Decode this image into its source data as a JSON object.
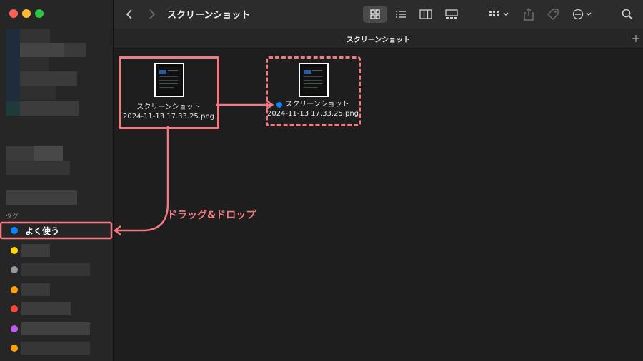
{
  "colors": {
    "accent": "#f07b82",
    "traffic": [
      "#ff5f57",
      "#febc2e",
      "#28c840"
    ],
    "tags": [
      "#0a84ff",
      "#ffd60a",
      "#98989d",
      "#ff9f0a",
      "#ff453a",
      "#bf5af2",
      "#ff9f0a"
    ]
  },
  "window": {
    "title": "スクリーンショット",
    "tab_title": "スクリーンショット"
  },
  "toolbar": {
    "icons": [
      "chevron-left-icon",
      "chevron-right-icon",
      "icon-view-icon",
      "list-view-icon",
      "column-view-icon",
      "gallery-view-icon",
      "group-icon",
      "share-icon",
      "tag-icon",
      "more-icon",
      "search-icon",
      "plus-icon"
    ]
  },
  "sidebar": {
    "tags_heading": "タグ",
    "favorite_tag": "よく使う"
  },
  "files": {
    "original": {
      "line1": "スクリーンショット",
      "line2": "2024-11-13 17.33.25.png"
    },
    "tagged": {
      "line1": "スクリーンショット",
      "line2": "2024-11-13 17.33.25.png"
    }
  },
  "annotation": {
    "drag_label": "ドラッグ&ドロップ"
  }
}
